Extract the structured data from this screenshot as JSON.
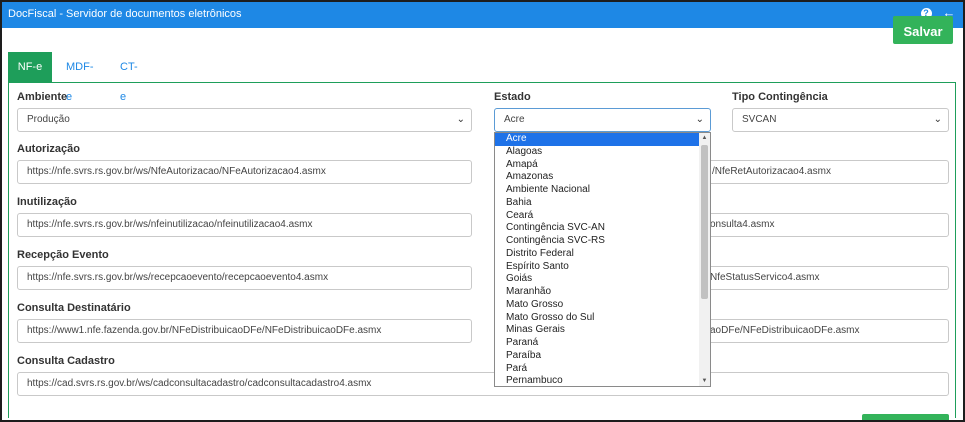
{
  "app": {
    "title": "DocFiscal - Servidor de documentos eletrônicos"
  },
  "titlebar": {
    "help_icon": "?",
    "back_icon": "←"
  },
  "toolbar": {
    "save_label": "Salvar"
  },
  "tabs": [
    {
      "label": "NF-e",
      "active": true
    },
    {
      "label": "MDF-e",
      "active": false
    },
    {
      "label": "CT-e",
      "active": false
    }
  ],
  "form": {
    "ambiente": {
      "label": "Ambiente",
      "value": "Produção"
    },
    "estado": {
      "label": "Estado",
      "value": "Acre"
    },
    "tipo_contingencia": {
      "label": "Tipo Contingência",
      "value": "SVCAN"
    },
    "autorizacao": {
      "label": "Autorização",
      "value": "https://nfe.svrs.rs.gov.br/ws/NfeAutorizacao/NFeAutorizacao4.asmx",
      "right_value": "/NfeRetAutorizacao4.asmx"
    },
    "inutilizacao": {
      "label": "Inutilização",
      "value": "https://nfe.svrs.rs.gov.br/ws/nfeinutilizacao/nfeinutilizacao4.asmx",
      "right_value": "onsulta4.asmx"
    },
    "recepcao_evento": {
      "label": "Recepção Evento",
      "value": "https://nfe.svrs.rs.gov.br/ws/recepcaoevento/recepcaoevento4.asmx",
      "right_value": "NfeStatusServico4.asmx"
    },
    "consulta_destinatario": {
      "label": "Consulta Destinatário",
      "value": "https://www1.nfe.fazenda.gov.br/NFeDistribuicaoDFe/NFeDistribuicaoDFe.asmx",
      "right_value": "aoDFe/NFeDistribuicaoDFe.asmx"
    },
    "consulta_cadastro": {
      "label": "Consulta Cadastro",
      "value": "https://cad.svrs.rs.gov.br/ws/cadconsultacadastro/cadconsultacadastro4.asmx"
    }
  },
  "estado_options": {
    "selected": "Acre",
    "items": [
      "Acre",
      "Alagoas",
      "Amapá",
      "Amazonas",
      "Ambiente Nacional",
      "Bahia",
      "Ceará",
      "Contingência SVC-AN",
      "Contingência SVC-RS",
      "Distrito Federal",
      "Espírito Santo",
      "Goiás",
      "Maranhão",
      "Mato Grosso",
      "Mato Grosso do Sul",
      "Minas Gerais",
      "Paraná",
      "Paraíba",
      "Pará",
      "Pernambuco"
    ]
  },
  "colors": {
    "titlebar": "#1e88e5",
    "save_button": "#33b35a",
    "tab_active": "#1e9e5a",
    "dropdown_selected": "#1e72e8"
  }
}
